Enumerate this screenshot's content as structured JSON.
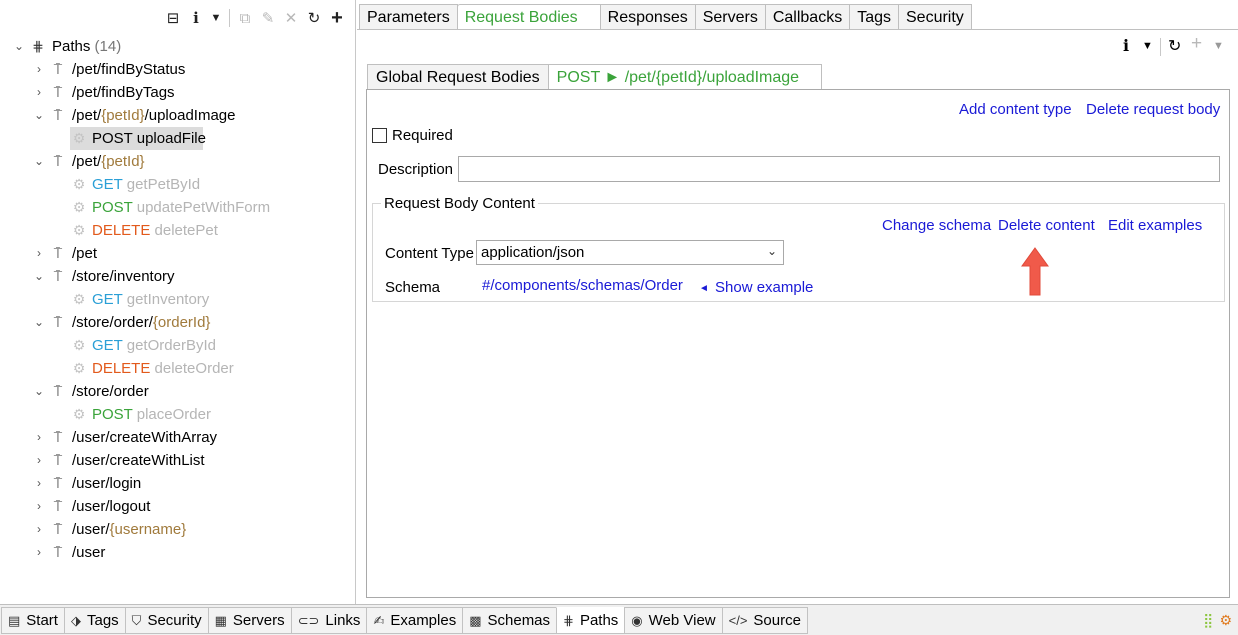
{
  "tree": {
    "root": {
      "label": "Paths",
      "count": "(14)"
    },
    "items": [
      {
        "path": "/pet/findByStatus"
      },
      {
        "path": "/pet/findByTags"
      },
      {
        "pre": "/pet/",
        "param": "{petId}",
        "post": "/uploadImage"
      },
      {
        "method": "POST",
        "name": "uploadFile"
      },
      {
        "pre": "/pet/",
        "param": "{petId}"
      },
      {
        "method": "GET",
        "name": "getPetById"
      },
      {
        "method": "POST",
        "name": "updatePetWithForm"
      },
      {
        "method": "DELETE",
        "name": "deletePet"
      },
      {
        "path": "/pet"
      },
      {
        "path": "/store/inventory"
      },
      {
        "method": "GET",
        "name": "getInventory"
      },
      {
        "pre": "/store/order/",
        "param": "{orderId}"
      },
      {
        "method": "GET",
        "name": "getOrderById"
      },
      {
        "method": "DELETE",
        "name": "deleteOrder"
      },
      {
        "path": "/store/order"
      },
      {
        "method": "POST",
        "name": "placeOrder"
      },
      {
        "path": "/user/createWithArray"
      },
      {
        "path": "/user/createWithList"
      },
      {
        "path": "/user/login"
      },
      {
        "path": "/user/logout"
      },
      {
        "pre": "/user/",
        "param": "{username}"
      },
      {
        "path": "/user"
      }
    ]
  },
  "top_tabs": [
    "Parameters",
    "Request Bodies",
    "Responses",
    "Servers",
    "Callbacks",
    "Tags",
    "Security"
  ],
  "inner_tabs": {
    "global": "Global Request Bodies",
    "active_method": "POST",
    "active_arrow": "►",
    "active_path": "/pet/{petId}/uploadImage"
  },
  "form": {
    "add_content_type": "Add content type",
    "delete_request_body": "Delete request body",
    "required_label": "Required",
    "description_label": "Description",
    "description_value": "",
    "group_title": "Request Body Content",
    "change_schema": "Change schema",
    "delete_content": "Delete content",
    "edit_examples": "Edit examples",
    "content_type_label": "Content Type",
    "content_type_value": "application/json",
    "schema_label": "Schema",
    "schema_ref": "#/components/schemas/Order",
    "show_example": "Show example"
  },
  "bottom_tabs": [
    "Start",
    "Tags",
    "Security",
    "Servers",
    "Links",
    "Examples",
    "Schemas",
    "Paths",
    "Web View",
    "Source"
  ],
  "colors": {
    "get": "#2a9fd6",
    "post": "#3aa33a",
    "delete": "#e25a1c",
    "link": "#1a1ad6",
    "arrow": "#f05a4a"
  }
}
